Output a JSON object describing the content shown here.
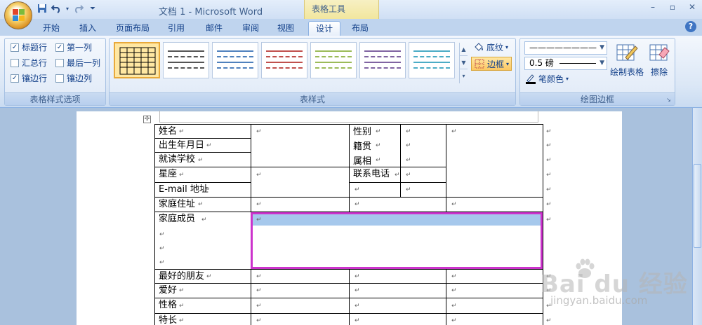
{
  "title_bar": {
    "app_title": "文档 1 - Microsoft Word",
    "context_label": "表格工具",
    "qat": [
      "save-icon",
      "undo-icon",
      "redo-icon",
      "customize-icon"
    ],
    "window_controls": [
      "–",
      "▫",
      "✕"
    ]
  },
  "tabs": [
    {
      "label": "开始",
      "active": false
    },
    {
      "label": "插入",
      "active": false
    },
    {
      "label": "页面布局",
      "active": false
    },
    {
      "label": "引用",
      "active": false
    },
    {
      "label": "邮件",
      "active": false
    },
    {
      "label": "审阅",
      "active": false
    },
    {
      "label": "视图",
      "active": false
    },
    {
      "label": "设计",
      "active": true
    },
    {
      "label": "布局",
      "active": false
    }
  ],
  "ribbon": {
    "style_options": {
      "label": "表格样式选项",
      "items": [
        {
          "label": "标题行",
          "checked": true
        },
        {
          "label": "第一列",
          "checked": true
        },
        {
          "label": "汇总行",
          "checked": false
        },
        {
          "label": "最后一列",
          "checked": false
        },
        {
          "label": "镶边行",
          "checked": true
        },
        {
          "label": "镶边列",
          "checked": false
        }
      ]
    },
    "table_styles": {
      "label": "表样式",
      "swatch_colors": [
        "#000000",
        "#555555",
        "#4f81bd",
        "#c0504d",
        "#9bbb59",
        "#8064a2",
        "#4bacc6"
      ],
      "shading_label": "底纹",
      "border_label": "边框"
    },
    "draw_borders": {
      "label": "绘图边框",
      "line_style": "————————",
      "line_weight": "0.5 磅",
      "pen_color_label": "笔颜色",
      "draw_table_label": "绘制表格",
      "eraser_label": "擦除"
    }
  },
  "table": {
    "r0": {
      "a": "姓名",
      "c": "性别"
    },
    "r1": {
      "a": "出生年月日",
      "c": "籍贯"
    },
    "r2": {
      "a": "就读学校",
      "c": "属相"
    },
    "r3": {
      "a": "星座",
      "c": "联系电话"
    },
    "r4": {
      "a": "E-mail 地址"
    },
    "r5": {
      "a": "家庭住址"
    },
    "r6": {
      "a": "家庭成员"
    },
    "r7": {
      "a": "最好的朋友"
    },
    "r8": {
      "a": "爱好"
    },
    "r9": {
      "a": "性格"
    },
    "r10": {
      "a": "特长"
    },
    "para_mark": "↵"
  },
  "watermark": {
    "brand": "Bai du 经验",
    "url": "jingyan.baidu.com"
  }
}
